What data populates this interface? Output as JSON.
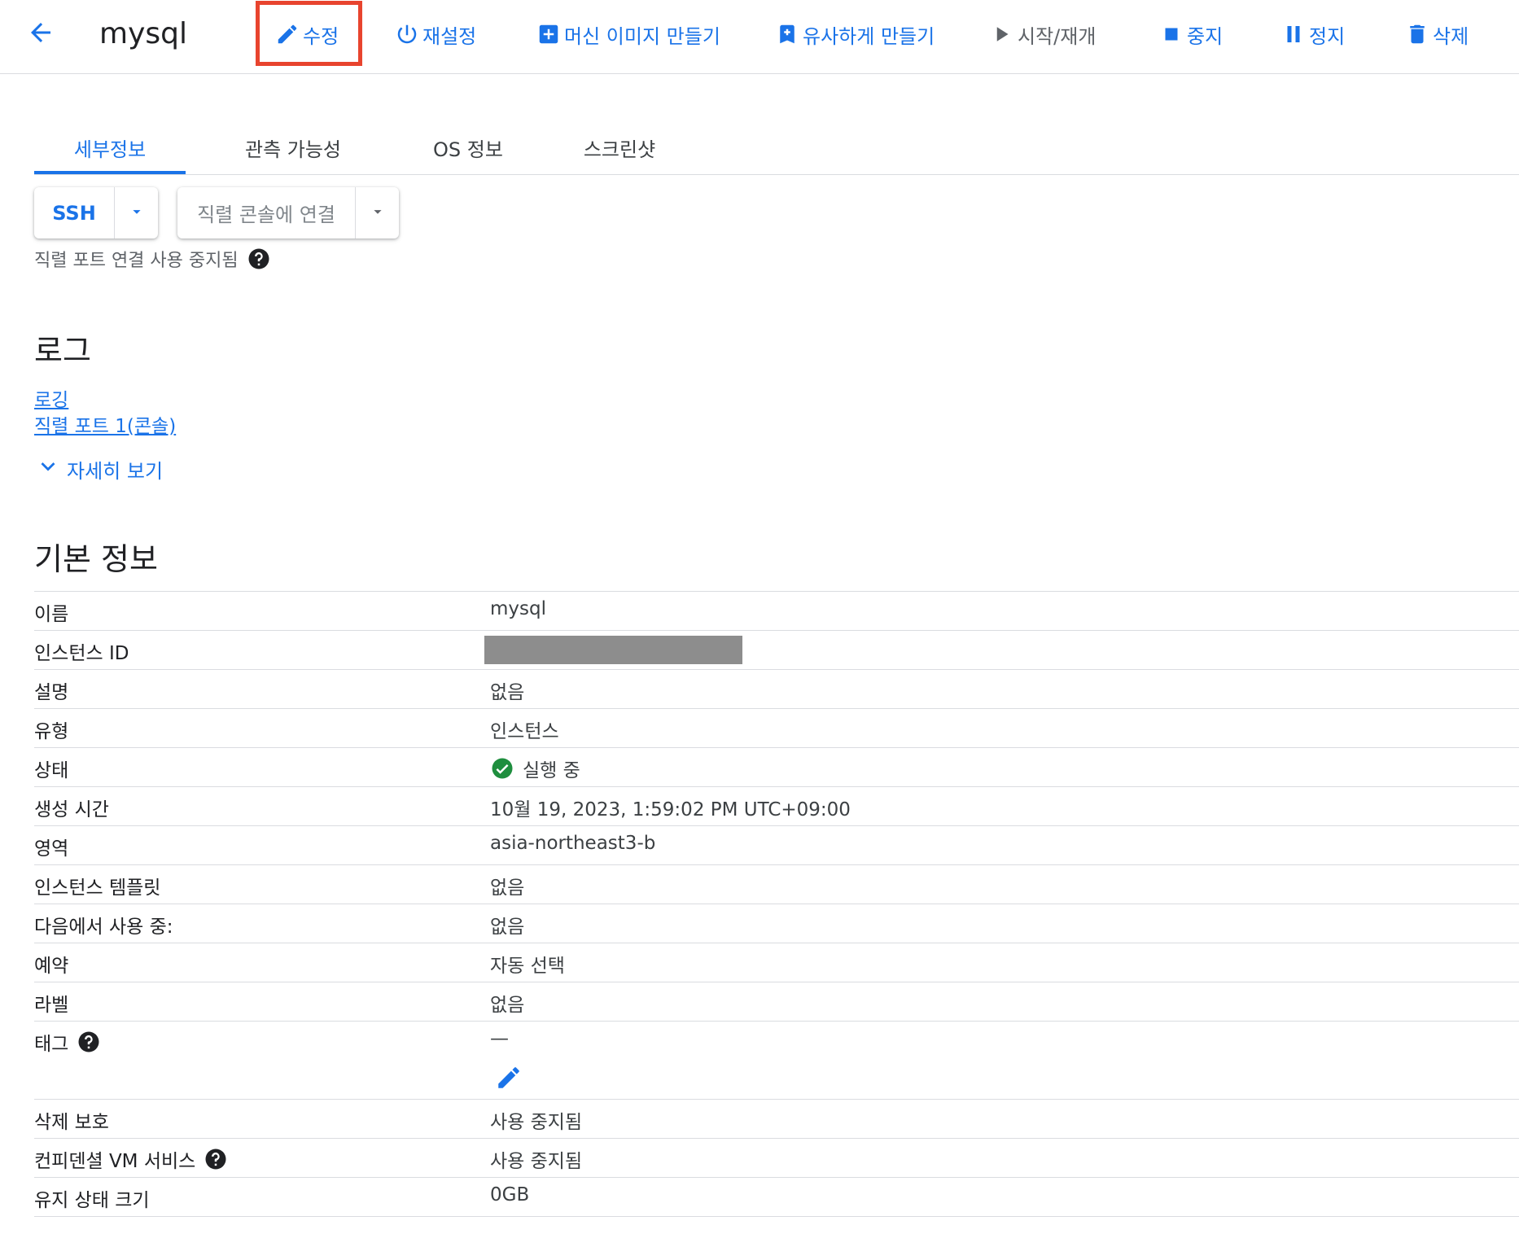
{
  "toolbar": {
    "title": "mysql",
    "edit": "수정",
    "reset": "재설정",
    "create_image": "머신 이미지 만들기",
    "create_similar": "유사하게 만들기",
    "start_resume": "시작/재개",
    "stop": "중지",
    "suspend": "정지",
    "delete": "삭제"
  },
  "tabs": [
    "세부정보",
    "관측 가능성",
    "OS 정보",
    "스크린샷"
  ],
  "connect": {
    "ssh": "SSH",
    "serial": "직렬 콘솔에 연결",
    "serial_note": "직렬 포트 연결 사용 중지됨"
  },
  "logs": {
    "heading": "로그",
    "links": [
      "로깅",
      "직렬 포트 1(콘솔)"
    ],
    "show_more": "자세히 보기"
  },
  "basic_info": {
    "heading": "기본 정보",
    "rows": [
      {
        "label": "이름",
        "value": "mysql"
      },
      {
        "label": "인스턴스 ID",
        "value": ""
      },
      {
        "label": "설명",
        "value": "없음"
      },
      {
        "label": "유형",
        "value": "인스턴스"
      },
      {
        "label": "상태",
        "value": "실행 중"
      },
      {
        "label": "생성 시간",
        "value": "10월 19, 2023, 1:59:02 PM UTC+09:00"
      },
      {
        "label": "영역",
        "value": "asia-northeast3-b"
      },
      {
        "label": "인스턴스 템플릿",
        "value": "없음"
      },
      {
        "label": "다음에서 사용 중:",
        "value": "없음"
      },
      {
        "label": "예약",
        "value": "자동 선택"
      },
      {
        "label": "라벨",
        "value": "없음"
      },
      {
        "label": "태그",
        "value": "—"
      },
      {
        "label": "삭제 보호",
        "value": "사용 중지됨"
      },
      {
        "label": "컨피덴셜 VM 서비스",
        "value": "사용 중지됨"
      },
      {
        "label": "유지 상태 크기",
        "value": "0GB"
      }
    ]
  },
  "colors": {
    "accent": "#1a73e8",
    "highlight": "#e8442e",
    "status_ok": "#1e8e3e"
  }
}
